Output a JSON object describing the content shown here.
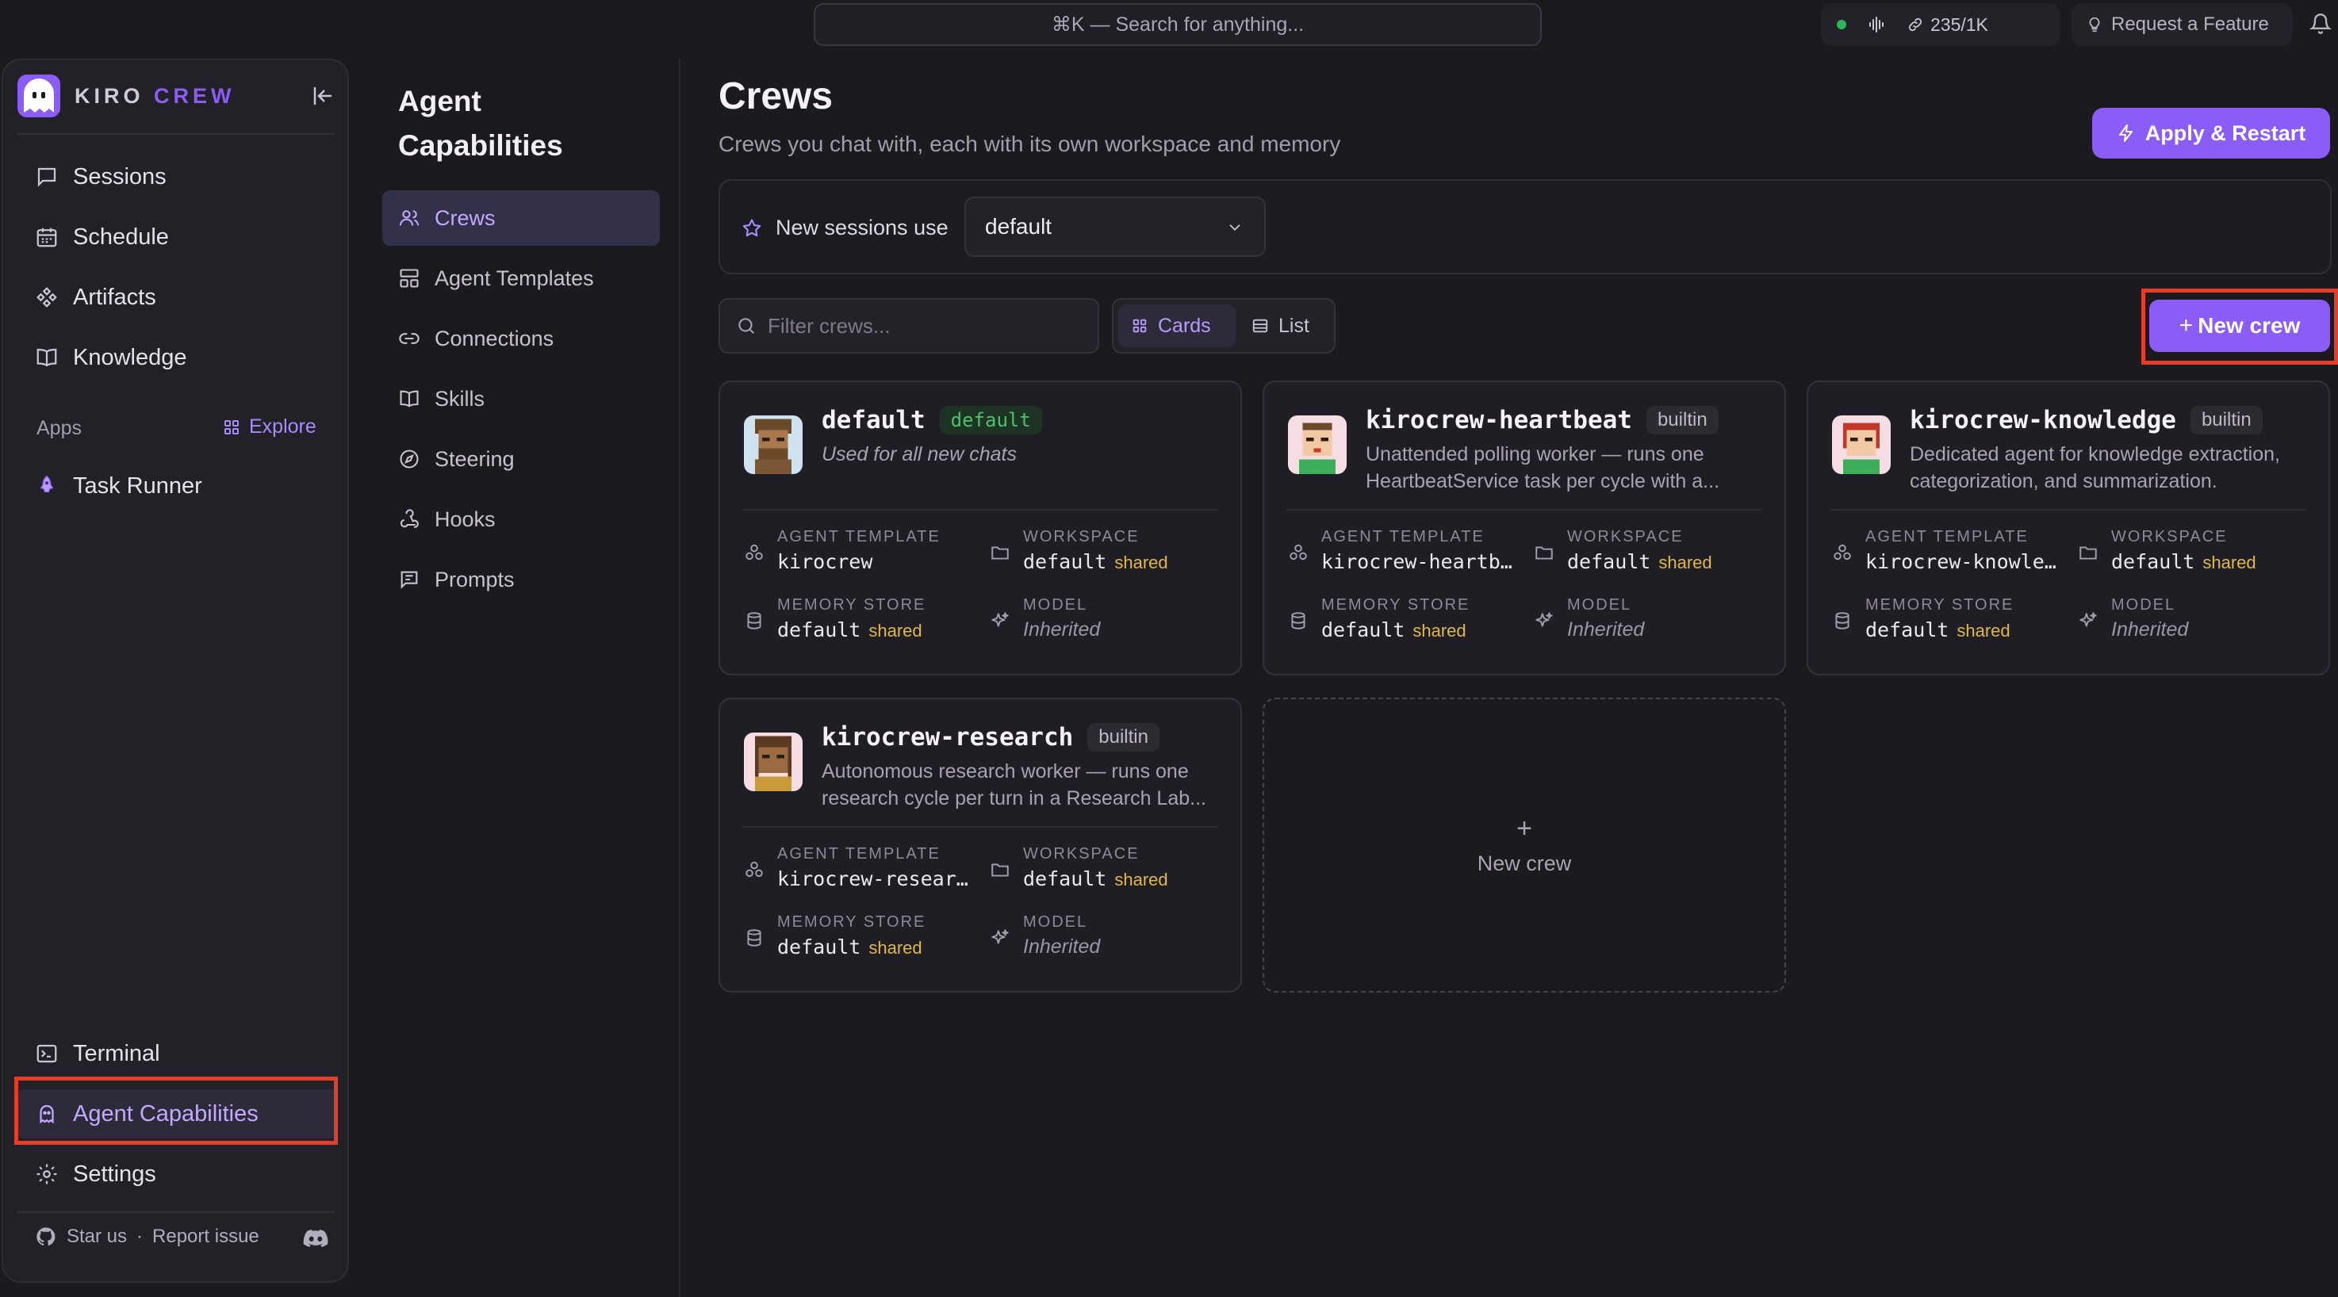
{
  "topbar": {
    "search_placeholder": "⌘K — Search for anything...",
    "usage": "235/1K",
    "request_feature": "Request a Feature"
  },
  "sidebar": {
    "brand_part1": "KIRO",
    "brand_part2": "CREW",
    "nav": [
      {
        "label": "Sessions",
        "icon": "chat-icon"
      },
      {
        "label": "Schedule",
        "icon": "calendar-icon"
      },
      {
        "label": "Artifacts",
        "icon": "artifacts-icon"
      },
      {
        "label": "Knowledge",
        "icon": "book-icon"
      }
    ],
    "apps_label": "Apps",
    "explore_label": "Explore",
    "apps": [
      {
        "label": "Task Runner",
        "icon": "rocket-icon"
      }
    ],
    "bottom": [
      {
        "label": "Terminal",
        "icon": "terminal-icon"
      },
      {
        "label": "Agent Capabilities",
        "icon": "ghost-icon",
        "active": true
      },
      {
        "label": "Settings",
        "icon": "gear-icon"
      }
    ],
    "footer_star": "Star us",
    "footer_sep": "·",
    "footer_report": "Report issue"
  },
  "capabilities": {
    "title_line1": "Agent",
    "title_line2": "Capabilities",
    "items": [
      {
        "label": "Crews",
        "active": true
      },
      {
        "label": "Agent Templates"
      },
      {
        "label": "Connections"
      },
      {
        "label": "Skills"
      },
      {
        "label": "Steering"
      },
      {
        "label": "Hooks"
      },
      {
        "label": "Prompts"
      }
    ]
  },
  "main": {
    "title": "Crews",
    "subtitle": "Crews you chat with, each with its own workspace and memory",
    "apply_label": "Apply & Restart",
    "new_sessions_label": "New sessions use",
    "new_sessions_value": "default",
    "filter_placeholder": "Filter crews...",
    "view_cards": "Cards",
    "view_list": "List",
    "new_crew_label": "New crew",
    "field_labels": {
      "agent_template": "AGENT TEMPLATE",
      "workspace": "WORKSPACE",
      "memory_store": "MEMORY STORE",
      "model": "MODEL",
      "shared": "shared"
    },
    "crews": [
      {
        "name": "default",
        "badge": "default",
        "description": "Used for all new chats",
        "agent_template": "kirocrew",
        "workspace": "default",
        "memory_store": "default",
        "model": "Inherited"
      },
      {
        "name": "kirocrew-heartbeat",
        "badge": "builtin",
        "description": "Unattended polling worker — runs one HeartbeatService task per cycle with a...",
        "agent_template": "kirocrew-heartb…",
        "workspace": "default",
        "memory_store": "default",
        "model": "Inherited"
      },
      {
        "name": "kirocrew-knowledge",
        "badge": "builtin",
        "description": "Dedicated agent for knowledge extraction, categorization, and summarization.",
        "agent_template": "kirocrew-knowle…",
        "workspace": "default",
        "memory_store": "default",
        "model": "Inherited"
      },
      {
        "name": "kirocrew-research",
        "badge": "builtin",
        "description": "Autonomous research worker — runs one research cycle per turn in a Research Lab...",
        "agent_template": "kirocrew-resear…",
        "workspace": "default",
        "memory_store": "default",
        "model": "Inherited"
      }
    ],
    "new_crew_card_label": "New crew"
  },
  "colors": {
    "accent": "#8b5cf6",
    "highlight_box": "#e53d2a",
    "shared_tag": "#e0b84a",
    "default_badge": "#4fbf6c"
  }
}
